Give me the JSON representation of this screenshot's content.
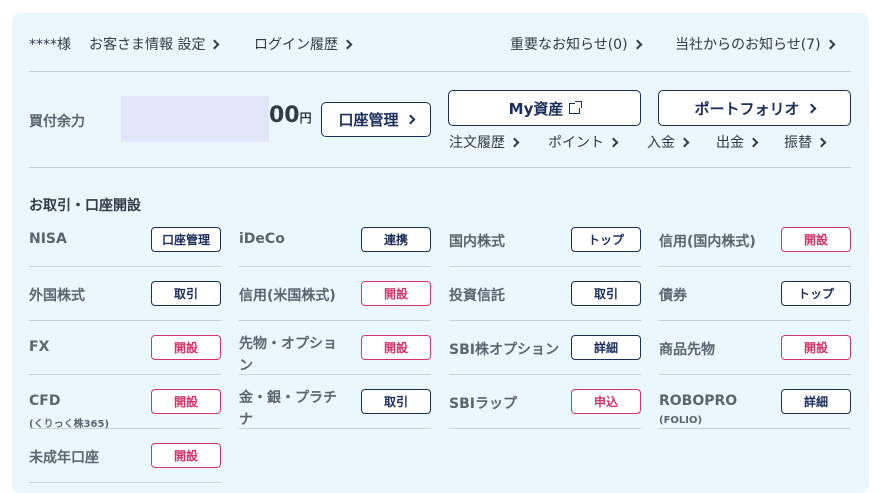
{
  "header": {
    "user": "****様",
    "links_left": [
      {
        "label": "お客さま情報 設定"
      },
      {
        "label": "ログイン履歴"
      }
    ],
    "links_right": [
      {
        "label": "重要なお知らせ(0)"
      },
      {
        "label": "当社からのお知らせ(7)"
      }
    ]
  },
  "balance": {
    "label": "買付余力",
    "amount_suffix": "00",
    "unit": "円",
    "account_button": "口座管理"
  },
  "buttons": {
    "my_assets": "My資産",
    "portfolio": "ポートフォリオ"
  },
  "sublinks": [
    {
      "label": "注文履歴"
    },
    {
      "label": "ポイント"
    },
    {
      "label": "入金"
    },
    {
      "label": "出金"
    },
    {
      "label": "振替"
    }
  ],
  "section": {
    "title": "お取引・口座開設",
    "items": [
      {
        "label": "NISA",
        "button": "口座管理",
        "style": "navy"
      },
      {
        "label": "iDeCo",
        "button": "連携",
        "style": "navy"
      },
      {
        "label": "国内株式",
        "button": "トップ",
        "style": "navy"
      },
      {
        "label": "信用(国内株式)",
        "button": "開設",
        "style": "pink"
      },
      {
        "label": "外国株式",
        "button": "取引",
        "style": "navy"
      },
      {
        "label": "信用(米国株式)",
        "button": "開設",
        "style": "pink"
      },
      {
        "label": "投資信託",
        "button": "取引",
        "style": "navy"
      },
      {
        "label": "債券",
        "button": "トップ",
        "style": "navy"
      },
      {
        "label": "FX",
        "button": "開設",
        "style": "pink"
      },
      {
        "label": "先物・オプション",
        "label_line1": "先物・オプショ",
        "label_line2": "ン",
        "button": "開設",
        "style": "pink"
      },
      {
        "label": "SBI株オプション",
        "button": "詳細",
        "style": "navy"
      },
      {
        "label": "商品先物",
        "button": "開設",
        "style": "pink"
      },
      {
        "label": "CFD",
        "sublabel": "(くりっく株365)",
        "button": "開設",
        "style": "pink"
      },
      {
        "label": "金・銀・プラチナ",
        "label_line1": "金・銀・プラチ",
        "label_line2": "ナ",
        "button": "取引",
        "style": "navy"
      },
      {
        "label": "SBIラップ",
        "button": "申込",
        "style": "pink"
      },
      {
        "label": "ROBOPRO",
        "sublabel": "(FOLIO)",
        "button": "詳細",
        "style": "navy"
      },
      {
        "label": "未成年口座",
        "button": "開設",
        "style": "pink"
      }
    ]
  },
  "colors": {
    "panel_bg": "#eaf7fd",
    "navy": "#1c2e5b",
    "pink": "#d1346b",
    "masked_amount": "#e2e6f8"
  }
}
